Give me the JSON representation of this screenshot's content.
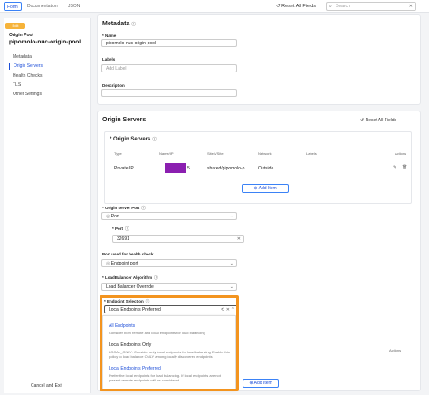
{
  "topbar": {
    "tabs": [
      "Form",
      "Documentation",
      "JSON"
    ],
    "reset_all": "Reset All Fields",
    "search_placeholder": "Search"
  },
  "sidebar": {
    "badge": "Edit",
    "kind": "Origin Pool",
    "name": "pipomolo-nuc-origin-pool",
    "nav": [
      "Metadata",
      "Origin Servers",
      "Health Checks",
      "TLS",
      "Other Settings"
    ],
    "cancel": "Cancel and Exit"
  },
  "metadata": {
    "title": "Metadata",
    "name_label": "* Name",
    "name_value": "pipomolo-nuc-origin-pool",
    "labels_label": "Labels",
    "labels_placeholder": "Add Label",
    "description_label": "Description"
  },
  "origin_servers": {
    "title": "Origin Servers",
    "reset": "Reset All Fields",
    "inner_title": "* Origin Servers",
    "columns": [
      "Type",
      "Name/IP",
      "Site/VSite",
      "Network",
      "Labels",
      "Actions"
    ],
    "row": {
      "type": "Private IP",
      "name_suffix": "5",
      "site": "shared/pipomolo-p...",
      "network": "Outside"
    },
    "add_item": "Add Item",
    "port_label": "* Origin server Port",
    "port_type": "Port",
    "port_sub_label": "* Port",
    "port_value": "32691",
    "health_port_label": "Port used for health check",
    "health_port_value": "Endpoint port",
    "lb_label": "* LoadBalancer Algorithm",
    "lb_value": "Load Balancer Override",
    "endpoint_label": "* Endpoint Selection",
    "endpoint_value": "Local Endpoints Preferred"
  },
  "dropdown": {
    "options": [
      {
        "title": "All Endpoints",
        "desc": "Consider both remote and local endpoints for load balancing"
      },
      {
        "title": "Local Endpoints Only",
        "desc": "LOCAL_ONLY: Consider only local endpoints for load balancing Enable this policy to load balance ONLY among locally discovered endpoints"
      },
      {
        "title": "Local Endpoints Preferred",
        "desc": "Prefer the local endpoints for load balancing. If local endpoints are not present remote endpoints will be considered"
      }
    ]
  },
  "lower": {
    "actions_header": "Actions",
    "add_item": "Add Item"
  }
}
